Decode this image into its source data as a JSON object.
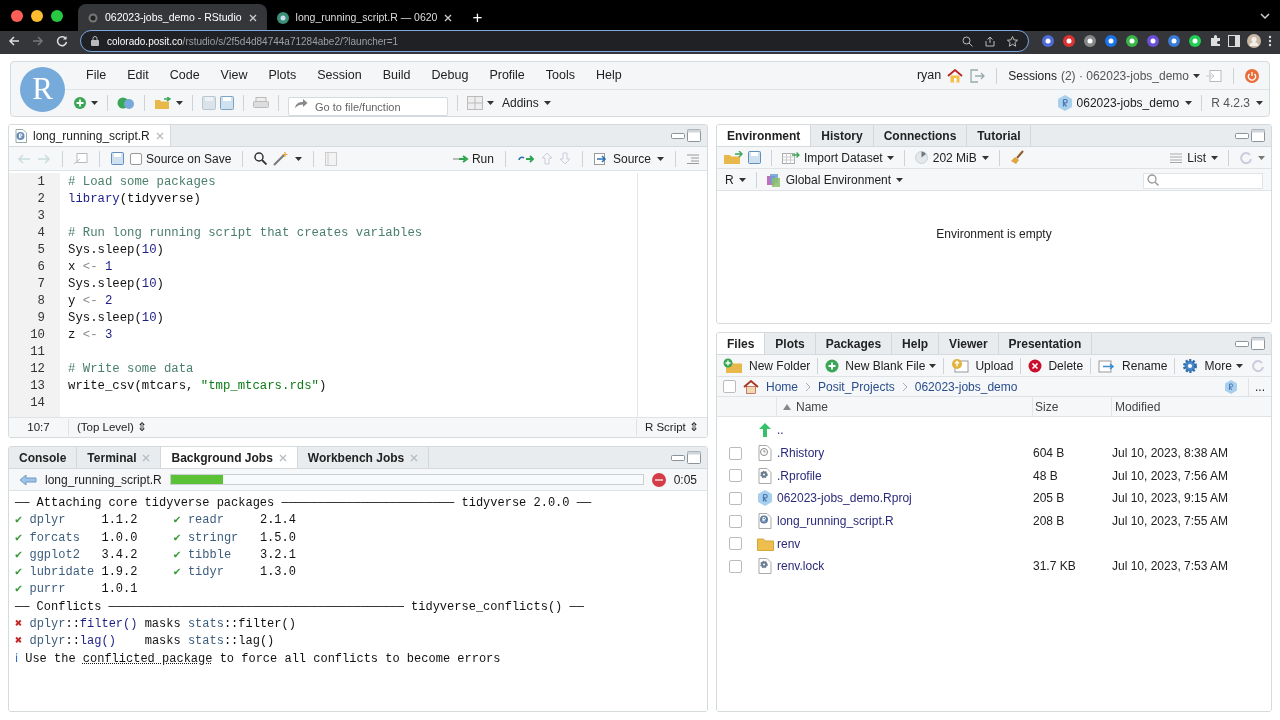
{
  "browser": {
    "tabs": [
      {
        "title": "062023-jobs_demo - RStudio",
        "kind": "rstudio",
        "selected": true
      },
      {
        "title": "long_running_script.R — 0620",
        "kind": "vscode",
        "selected": false
      }
    ],
    "new_tab": "+",
    "url_host": "colorado.posit.co",
    "url_path": "/rstudio/s/2f5d4d84744a71284abe2/?launcher=1"
  },
  "rstudio": {
    "logo": "R",
    "menu": [
      "File",
      "Edit",
      "Code",
      "View",
      "Plots",
      "Session",
      "Build",
      "Debug",
      "Profile",
      "Tools",
      "Help"
    ],
    "user": "ryan",
    "sessions_label": "Sessions",
    "sessions_detail": "(2) · 062023-jobs_demo",
    "goto_placeholder": "Go to file/function",
    "addins": "Addins",
    "project": "062023-jobs_demo",
    "r_version": "R 4.2.3"
  },
  "editor": {
    "tab": "long_running_script.R",
    "source_on_save": {
      "label": "Source on Save",
      "checked": false
    },
    "run": "Run",
    "source": "Source",
    "lines": [
      {
        "n": "1",
        "tokens": [
          {
            "kind": "comment",
            "text": "# Load some packages"
          }
        ]
      },
      {
        "n": "2",
        "tokens": [
          {
            "kind": "fn",
            "text": "library"
          },
          {
            "kind": "plain",
            "text": "(tidyverse)"
          }
        ]
      },
      {
        "n": "3"
      },
      {
        "n": "4",
        "tokens": [
          {
            "kind": "comment",
            "text": "# Run long running script that creates variables"
          }
        ]
      },
      {
        "n": "5",
        "tokens": [
          {
            "kind": "plain",
            "text": "Sys.sleep("
          },
          {
            "kind": "num",
            "text": "10"
          },
          {
            "kind": "plain",
            "text": ")"
          }
        ]
      },
      {
        "n": "6",
        "tokens": [
          {
            "kind": "plain",
            "text": "x "
          },
          {
            "kind": "op",
            "text": "<-"
          },
          {
            "kind": "num",
            "text": " 1"
          }
        ]
      },
      {
        "n": "7",
        "tokens": [
          {
            "kind": "plain",
            "text": "Sys.sleep("
          },
          {
            "kind": "num",
            "text": "10"
          },
          {
            "kind": "plain",
            "text": ")"
          }
        ]
      },
      {
        "n": "8",
        "tokens": [
          {
            "kind": "plain",
            "text": "y "
          },
          {
            "kind": "op",
            "text": "<-"
          },
          {
            "kind": "num",
            "text": " 2"
          }
        ]
      },
      {
        "n": "9",
        "tokens": [
          {
            "kind": "plain",
            "text": "Sys.sleep("
          },
          {
            "kind": "num",
            "text": "10"
          },
          {
            "kind": "plain",
            "text": ")"
          }
        ]
      },
      {
        "n": "10",
        "tokens": [
          {
            "kind": "plain",
            "text": "z "
          },
          {
            "kind": "op",
            "text": "<-"
          },
          {
            "kind": "num",
            "text": " 3"
          }
        ]
      },
      {
        "n": "11"
      },
      {
        "n": "12",
        "tokens": [
          {
            "kind": "comment",
            "text": "# Write some data"
          }
        ]
      },
      {
        "n": "13",
        "tokens": [
          {
            "kind": "plain",
            "text": "write_csv(mtcars, "
          },
          {
            "kind": "str",
            "text": "\"tmp_mtcars.rds\""
          },
          {
            "kind": "plain",
            "text": ")"
          }
        ]
      },
      {
        "n": "14"
      }
    ],
    "position": "10:7",
    "scope": "(Top Level) ⇕",
    "filetype": "R Script ⇕"
  },
  "console": {
    "tabs": [
      {
        "label": "Console",
        "closable": false,
        "selected": false
      },
      {
        "label": "Terminal",
        "closable": true,
        "selected": false
      },
      {
        "label": "Background Jobs",
        "closable": true,
        "selected": true
      },
      {
        "label": "Workbench Jobs",
        "closable": true,
        "selected": false
      }
    ],
    "job": {
      "name": "long_running_script.R",
      "level": 0.11,
      "elapsed": "0:05"
    },
    "lines": [
      [
        {
          "kind": "plain",
          "text": "── Attaching core tidyverse packages ──────────────────────── tidyverse 2.0.0 ──"
        }
      ],
      [
        {
          "kind": "check",
          "text": "✔"
        },
        {
          "kind": "pkg",
          "text": " dplyr"
        },
        {
          "kind": "plain",
          "text": "     1.1.2     "
        },
        {
          "kind": "check",
          "text": "✔"
        },
        {
          "kind": "pkg",
          "text": " readr"
        },
        {
          "kind": "plain",
          "text": "     2.1.4"
        }
      ],
      [
        {
          "kind": "check",
          "text": "✔"
        },
        {
          "kind": "pkg",
          "text": " forcats"
        },
        {
          "kind": "plain",
          "text": "   1.0.0     "
        },
        {
          "kind": "check",
          "text": "✔"
        },
        {
          "kind": "pkg",
          "text": " stringr"
        },
        {
          "kind": "plain",
          "text": "   1.5.0"
        }
      ],
      [
        {
          "kind": "check",
          "text": "✔"
        },
        {
          "kind": "pkg",
          "text": " ggplot2"
        },
        {
          "kind": "plain",
          "text": "   3.4.2     "
        },
        {
          "kind": "check",
          "text": "✔"
        },
        {
          "kind": "pkg",
          "text": " tibble"
        },
        {
          "kind": "plain",
          "text": "    3.2.1"
        }
      ],
      [
        {
          "kind": "check",
          "text": "✔"
        },
        {
          "kind": "pkg",
          "text": " lubridate"
        },
        {
          "kind": "plain",
          "text": " 1.9.2     "
        },
        {
          "kind": "check",
          "text": "✔"
        },
        {
          "kind": "pkg",
          "text": " tidyr"
        },
        {
          "kind": "plain",
          "text": "     1.3.0"
        }
      ],
      [
        {
          "kind": "check",
          "text": "✔"
        },
        {
          "kind": "pkg",
          "text": " purrr"
        },
        {
          "kind": "plain",
          "text": "     1.0.1"
        }
      ],
      [
        {
          "kind": "plain",
          "text": "── Conflicts ───────────────────────────────────────── tidyverse_conflicts() ──"
        }
      ],
      [
        {
          "kind": "cross",
          "text": "✖"
        },
        {
          "kind": "pkg",
          "text": " dplyr"
        },
        {
          "kind": "plain",
          "text": "::"
        },
        {
          "kind": "fn",
          "text": "filter()"
        },
        {
          "kind": "plain",
          "text": " masks "
        },
        {
          "kind": "pkg",
          "text": "stats"
        },
        {
          "kind": "plain",
          "text": "::filter()"
        }
      ],
      [
        {
          "kind": "cross",
          "text": "✖"
        },
        {
          "kind": "pkg",
          "text": " dplyr"
        },
        {
          "kind": "plain",
          "text": "::"
        },
        {
          "kind": "fn",
          "text": "lag()"
        },
        {
          "kind": "plain",
          "text": "    masks "
        },
        {
          "kind": "pkg",
          "text": "stats"
        },
        {
          "kind": "plain",
          "text": "::lag()"
        }
      ],
      [
        {
          "kind": "info",
          "text": "ℹ"
        },
        {
          "kind": "plain",
          "text": " Use the "
        },
        {
          "kind": "link",
          "text": "conflicted package"
        },
        {
          "kind": "plain",
          "text": " to force all conflicts to become errors"
        }
      ]
    ]
  },
  "environment": {
    "tabs": [
      {
        "label": "Environment",
        "selected": true
      },
      {
        "label": "History",
        "selected": false
      },
      {
        "label": "Connections",
        "selected": false
      },
      {
        "label": "Tutorial",
        "selected": false
      }
    ],
    "import": "Import Dataset",
    "memory": "202 MiB",
    "view": "List",
    "language": "R",
    "scope": "Global Environment",
    "message": "Environment is empty"
  },
  "files": {
    "tabs": [
      {
        "label": "Files",
        "selected": true
      },
      {
        "label": "Plots",
        "selected": false
      },
      {
        "label": "Packages",
        "selected": false
      },
      {
        "label": "Help",
        "selected": false
      },
      {
        "label": "Viewer",
        "selected": false
      },
      {
        "label": "Presentation",
        "selected": false
      }
    ],
    "actions": [
      {
        "kind": "folder",
        "label": "New Folder",
        "menu": false
      },
      {
        "kind": "new",
        "label": "New Blank File",
        "menu": true
      },
      {
        "kind": "upload",
        "label": "Upload",
        "menu": false
      },
      {
        "kind": "delete",
        "label": "Delete",
        "menu": false
      },
      {
        "kind": "rename",
        "label": "Rename",
        "menu": false
      },
      {
        "kind": "more",
        "label": "More",
        "menu": true
      }
    ],
    "select_all": {
      "checked": false
    },
    "breadcrumb": [
      "Home",
      "Posit_Projects",
      "062023-jobs_demo"
    ],
    "overflow": "...",
    "columns": [
      "Name",
      "Size",
      "Modified"
    ],
    "rows": [
      {
        "kind": "up",
        "name": ".."
      },
      {
        "kind": "history",
        "name": ".Rhistory",
        "size": "604 B",
        "modified": "Jul 10, 2023, 8:38 AM",
        "checked": false
      },
      {
        "kind": "settings",
        "name": ".Rprofile",
        "size": "48 B",
        "modified": "Jul 10, 2023, 7:56 AM",
        "checked": false
      },
      {
        "kind": "rproj",
        "name": "062023-jobs_demo.Rproj",
        "size": "205 B",
        "modified": "Jul 10, 2023, 9:15 AM",
        "checked": false
      },
      {
        "kind": "rscript",
        "name": "long_running_script.R",
        "size": "208 B",
        "modified": "Jul 10, 2023, 7:55 AM",
        "checked": false
      },
      {
        "kind": "folder",
        "name": "renv",
        "checked": false
      },
      {
        "kind": "settings",
        "name": "renv.lock",
        "size": "31.7 KB",
        "modified": "Jul 10, 2023, 7:53 AM",
        "checked": false
      }
    ]
  }
}
